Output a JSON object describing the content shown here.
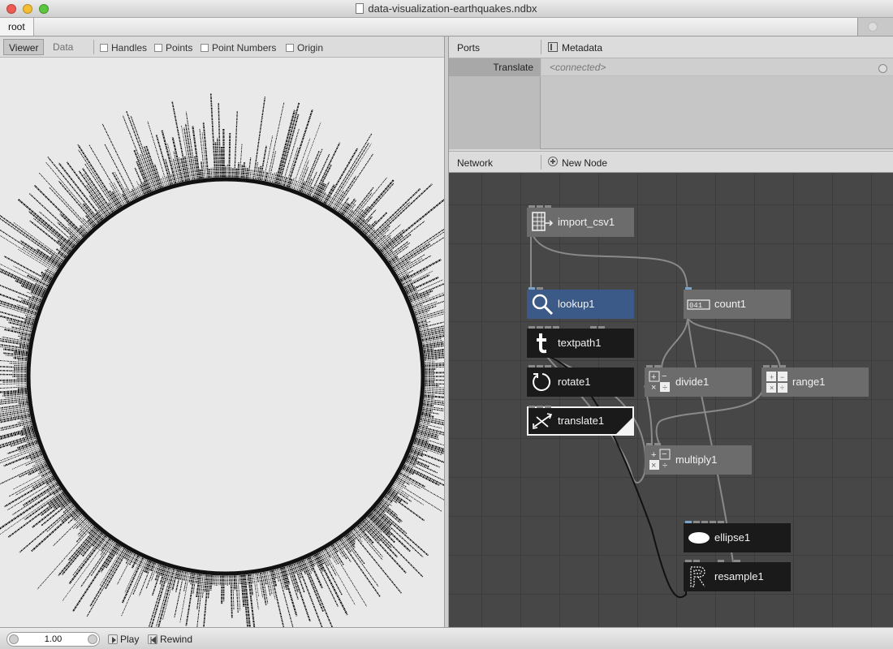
{
  "window": {
    "title": "data-visualization-earthquakes.ndbx"
  },
  "breadcrumb": {
    "root": "root"
  },
  "viewer": {
    "tabs": [
      "Viewer",
      "Data"
    ],
    "options": [
      "Handles",
      "Points",
      "Point Numbers",
      "Origin"
    ]
  },
  "ports": {
    "header": "Ports",
    "metadata": "Metadata",
    "rows": [
      {
        "name": "Translate",
        "value": "<connected>"
      }
    ]
  },
  "network": {
    "header": "Network",
    "new_node": "New Node",
    "nodes": [
      {
        "label": "import_csv1",
        "style": "gray",
        "icon": "table-import-icon"
      },
      {
        "label": "lookup1",
        "style": "blue",
        "icon": "magnifier-icon"
      },
      {
        "label": "textpath1",
        "style": "dark",
        "icon": "text-t-icon"
      },
      {
        "label": "rotate1",
        "style": "dark",
        "icon": "rotate-icon"
      },
      {
        "label": "translate1",
        "style": "selected",
        "icon": "translate-arrows-icon"
      },
      {
        "label": "count1",
        "style": "gray",
        "icon": "counter-icon"
      },
      {
        "label": "divide1",
        "style": "gray",
        "icon": "math-ops-icon"
      },
      {
        "label": "range1",
        "style": "gray",
        "icon": "range-grid-icon"
      },
      {
        "label": "multiply1",
        "style": "gray",
        "icon": "math-ops-icon"
      },
      {
        "label": "ellipse1",
        "style": "dark",
        "icon": "ellipse-icon"
      },
      {
        "label": "resample1",
        "style": "dark",
        "icon": "resample-r-icon"
      }
    ]
  },
  "playback": {
    "frame": "1.00",
    "play": "Play",
    "rewind": "Rewind"
  },
  "colors": {
    "network_bg": "#474747",
    "node_gray": "#6c6c6c",
    "node_dark": "#1a1a1a",
    "node_selected": "#3c5a87"
  }
}
